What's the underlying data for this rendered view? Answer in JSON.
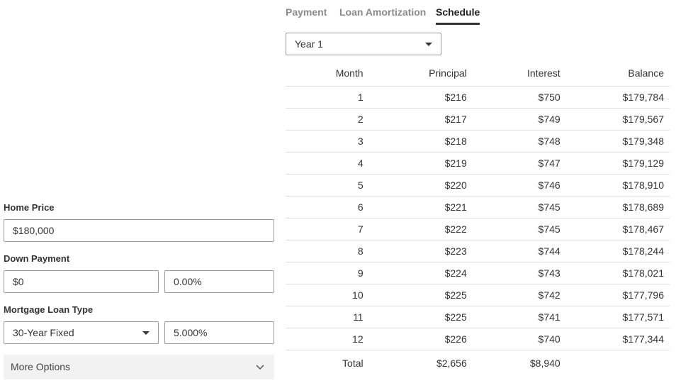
{
  "form": {
    "home_price_label": "Home Price",
    "home_price_value": "$180,000",
    "down_payment_label": "Down Payment",
    "down_payment_value": "$0",
    "down_payment_percent": "0.00%",
    "loan_type_label": "Mortgage Loan Type",
    "loan_type_value": "30-Year Fixed",
    "interest_rate": "5.000%",
    "more_options_label": "More Options"
  },
  "tabs": [
    {
      "label": "Payment",
      "active": false
    },
    {
      "label": "Loan Amortization",
      "active": false
    },
    {
      "label": "Schedule",
      "active": true
    }
  ],
  "year_select": "Year 1",
  "schedule": {
    "headers": [
      "Month",
      "Principal",
      "Interest",
      "Balance"
    ],
    "rows": [
      [
        "1",
        "$216",
        "$750",
        "$179,784"
      ],
      [
        "2",
        "$217",
        "$749",
        "$179,567"
      ],
      [
        "3",
        "$218",
        "$748",
        "$179,348"
      ],
      [
        "4",
        "$219",
        "$747",
        "$179,129"
      ],
      [
        "5",
        "$220",
        "$746",
        "$178,910"
      ],
      [
        "6",
        "$221",
        "$745",
        "$178,689"
      ],
      [
        "7",
        "$222",
        "$745",
        "$178,467"
      ],
      [
        "8",
        "$223",
        "$744",
        "$178,244"
      ],
      [
        "9",
        "$224",
        "$743",
        "$178,021"
      ],
      [
        "10",
        "$225",
        "$742",
        "$177,796"
      ],
      [
        "11",
        "$225",
        "$741",
        "$177,571"
      ],
      [
        "12",
        "$226",
        "$740",
        "$177,344"
      ]
    ],
    "total": [
      "Total",
      "$2,656",
      "$8,940",
      ""
    ]
  },
  "icons": {
    "dropdown": "caret-down-icon",
    "more_options": "chevron-down-icon"
  },
  "colors": {
    "active_tab_underline": "#333333",
    "inactive_tab": "#8a8a8a",
    "row_divider": "#dddddd",
    "more_options_bg": "#f2f2f2"
  }
}
